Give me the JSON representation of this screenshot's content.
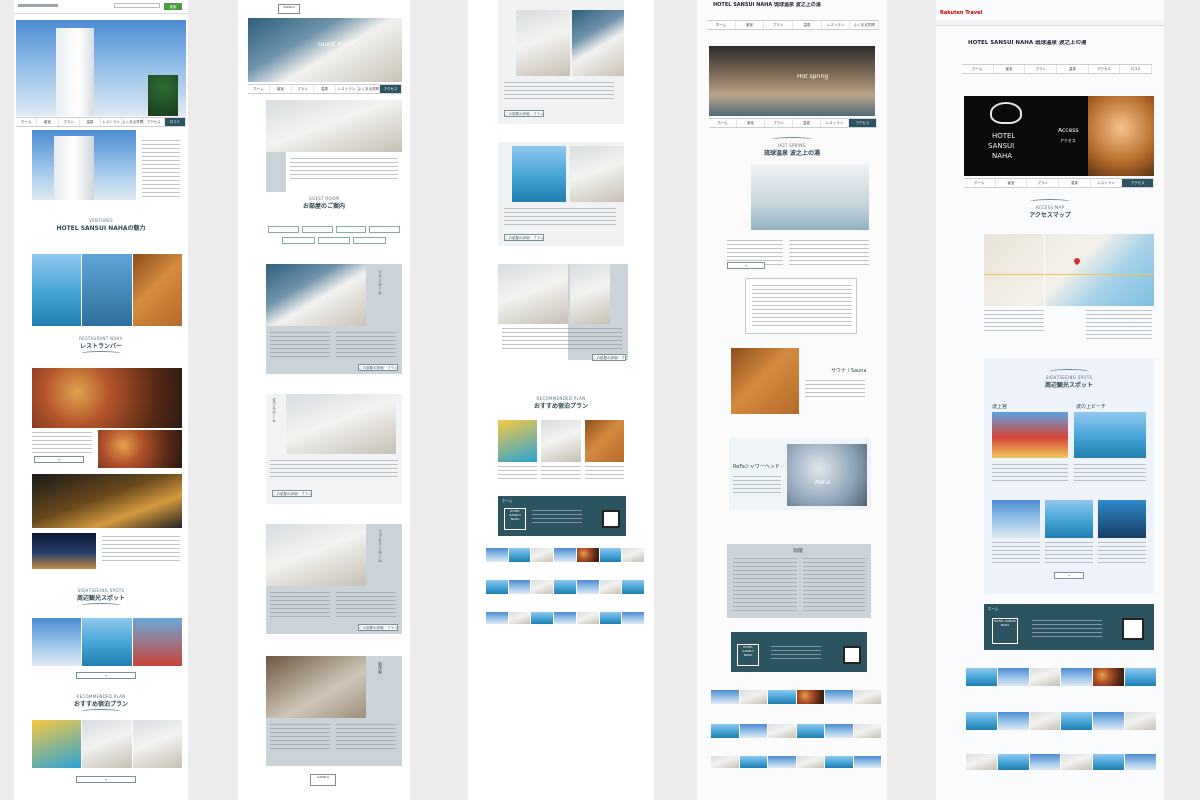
{
  "col1": {
    "hotel_title": "HOTEL SANSUI NAHAの魅力",
    "hotel_en": "VENTURES",
    "restaurant_en": "RESTAURANT NAHA",
    "restaurant_ja": "レストランバー",
    "spots_en": "SIGHTSEEING SPOTS",
    "spots_ja": "周辺観光スポット",
    "plan_en": "RECOMMENDED PLAN",
    "plan_ja": "おすすめ宿泊プラン",
    "search_btn": "検索"
  },
  "col2": {
    "banner_label": "Guest Room",
    "rooms_en": "GUEST ROOM",
    "rooms_ja": "お部屋のご案内",
    "rooms_vertical": [
      "ツインルーム",
      "ダブルルーム",
      "ファミリールーム",
      "和洋室"
    ],
    "detail_btn": "この部屋の詳細・プランを見る"
  },
  "col3": {
    "plan_en": "RECOMMENDED PLAN",
    "plan_ja": "おすすめ宿泊プラン",
    "footer_hotel": "HOTEL SANSUI NAHA",
    "detail_btn": "この部屋の詳細・プランを見る"
  },
  "col4": {
    "header_title": "HOTEL SANSUI NAHA 琉球温泉 波之上の湯",
    "banner_label": "Hot spring",
    "spring_en": "HOT SPRING",
    "spring_ja": "琉球温泉 波之上の湯",
    "sauna_label": "サウナ / Sauna",
    "refa_label": "ReFaシャワーヘッド",
    "refa_logo": "ReFa",
    "spa_title": "効能",
    "footer_hotel": "HOTEL SANSUI NAHA"
  },
  "col5": {
    "rakuten": "Rakuten Travel",
    "header_title": "HOTEL SANSUI NAHA 琉球温泉 波之上の湯",
    "access_en": "Access",
    "access_ja": "アクセス",
    "hotel_sign": [
      "HOTEL",
      "SANSUI",
      "NAHA"
    ],
    "map_en": "ACCESS MAP",
    "map_ja": "アクセスマップ",
    "spots_en": "SIGHTSEEING SPOTS",
    "spots_ja": "周辺観光スポット",
    "spot1": "波上宮",
    "spot2": "波の上ビーチ",
    "footer_hotel": "HOTEL SANSUI NAHA"
  },
  "nav": [
    "ホーム",
    "客室",
    "プラン",
    "温泉",
    "レストラン",
    "よくある質問",
    "アクセス",
    "口コミ"
  ],
  "colors": {
    "brand": "#2c5360",
    "panel": "#c9d3d8",
    "rakuten": "#bf0000"
  }
}
